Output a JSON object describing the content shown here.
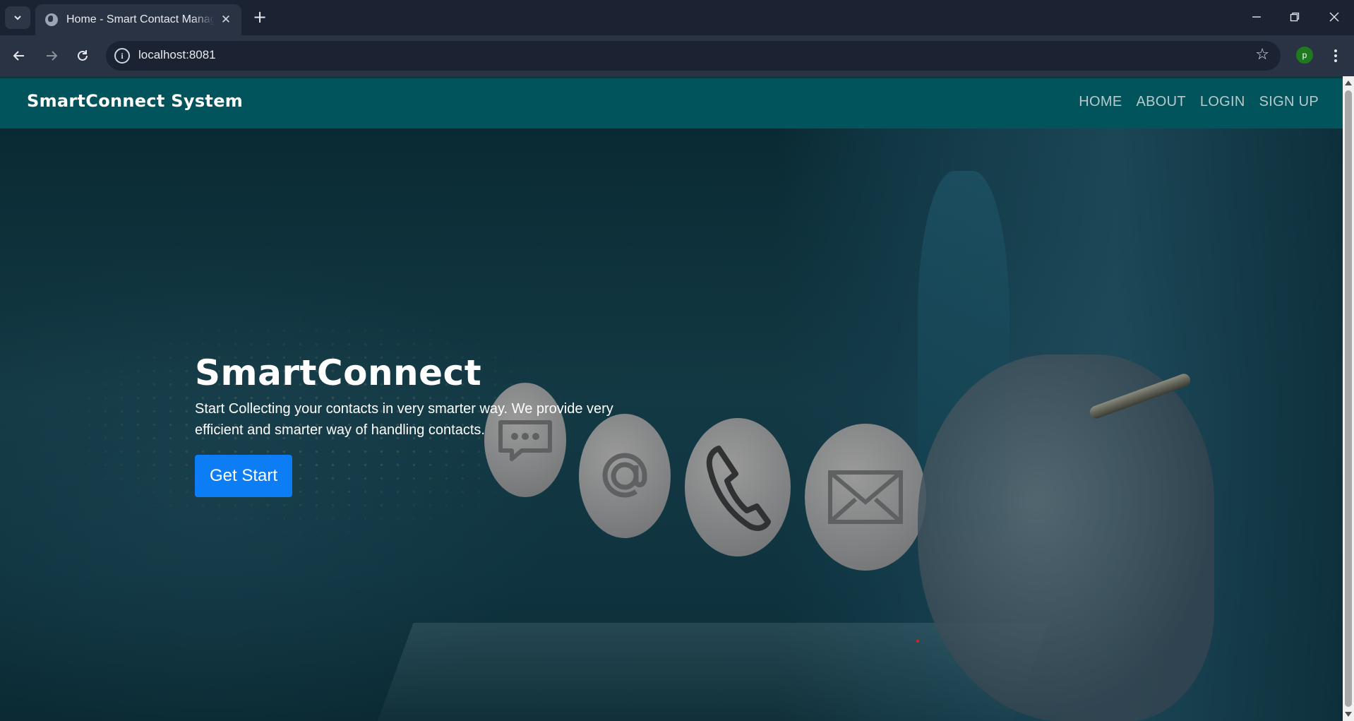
{
  "browser": {
    "tab_title": "Home - Smart Contact Manager",
    "url": "localhost:8081",
    "profile_initial": "p",
    "new_tab_symbol": "+",
    "tab_close_symbol": "✕"
  },
  "site": {
    "brand": "SmartConnect System",
    "nav": {
      "home": "HOME",
      "about": "ABOUT",
      "login": "LOGIN",
      "signup": "SIGN UP"
    }
  },
  "hero": {
    "title": "SmartConnect",
    "description": "Start Collecting your contacts in very smarter way. We provide very efficient and smarter way of handling contacts.",
    "cta_label": "Get Start"
  },
  "icons": {
    "contact_bubbles": [
      "chat-icon",
      "at-sign-icon",
      "phone-icon",
      "envelope-icon"
    ]
  },
  "colors": {
    "navbar": "#02545c",
    "cta": "#0d7df5",
    "chrome": "#2a3344"
  }
}
